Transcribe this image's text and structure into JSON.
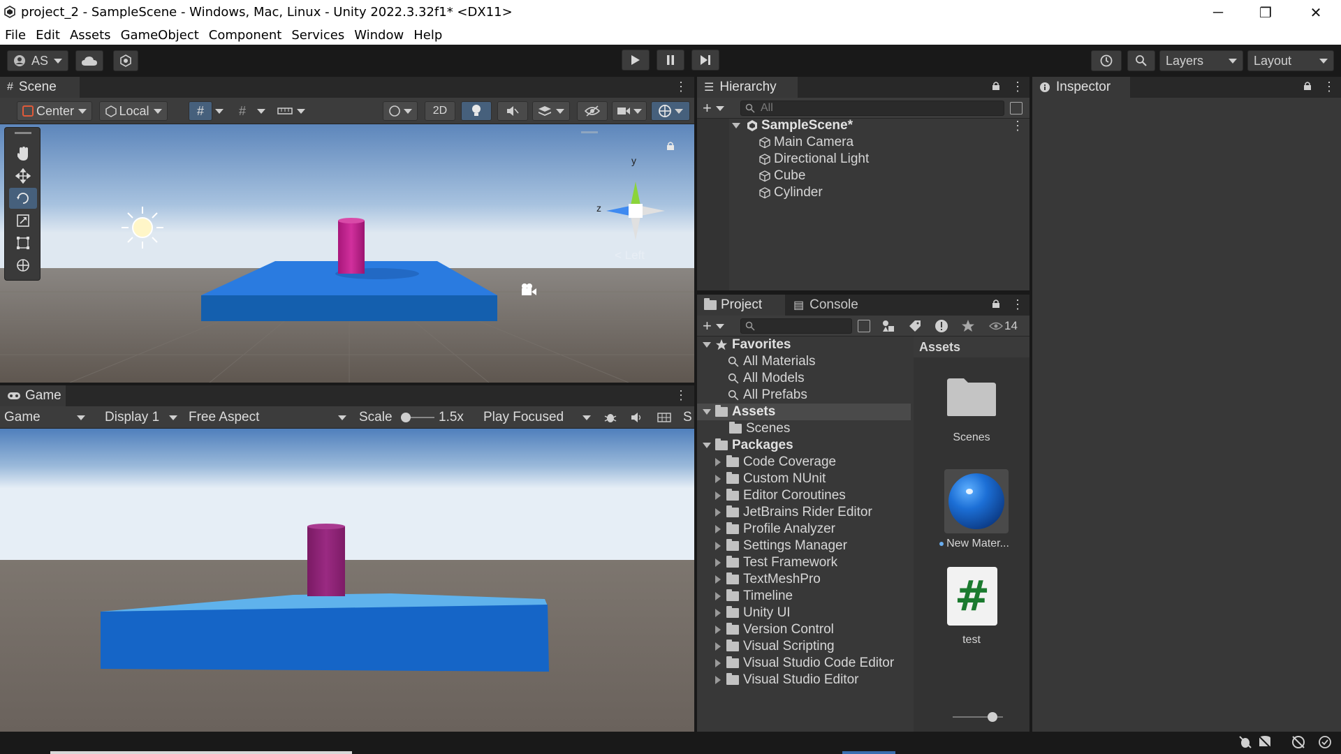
{
  "window": {
    "title": "project_2 - SampleScene - Windows, Mac, Linux - Unity 2022.3.32f1* <DX11>",
    "minimize_glyph": "─",
    "restore_glyph": "❐",
    "close_glyph": "✕"
  },
  "menu": [
    "File",
    "Edit",
    "Assets",
    "GameObject",
    "Component",
    "Services",
    "Window",
    "Help"
  ],
  "toolbar": {
    "account_label": "AS",
    "layers_label": "Layers",
    "layout_label": "Layout"
  },
  "scene": {
    "tab_label": "Scene",
    "pivot_label": "Center",
    "space_label": "Local",
    "mode_2d_label": "2D",
    "gizmo_y": "y",
    "gizmo_z": "z",
    "gizmo_view_label": "< Left"
  },
  "game": {
    "tab_label": "Game",
    "view_dropdown": "Game",
    "display_dropdown": "Display 1",
    "aspect_dropdown": "Free Aspect",
    "scale_label": "Scale",
    "scale_value": "1.5x",
    "play_mode_dropdown": "Play Focused",
    "cut_label": "S"
  },
  "hierarchy": {
    "tab_label": "Hierarchy",
    "search_placeholder": "All",
    "scene_name": "SampleScene*",
    "objects": [
      "Main Camera",
      "Directional Light",
      "Cube",
      "Cylinder"
    ]
  },
  "inspector": {
    "tab_label": "Inspector"
  },
  "project": {
    "tab_label": "Project",
    "console_tab_label": "Console",
    "hidden_count": "14",
    "favorites_label": "Favorites",
    "favorites": [
      "All Materials",
      "All Models",
      "All Prefabs"
    ],
    "assets_label": "Assets",
    "assets_children": [
      "Scenes"
    ],
    "packages_label": "Packages",
    "packages": [
      "Code Coverage",
      "Custom NUnit",
      "Editor Coroutines",
      "JetBrains Rider Editor",
      "Profile Analyzer",
      "Settings Manager",
      "Test Framework",
      "TextMeshPro",
      "Timeline",
      "Unity UI",
      "Version Control",
      "Visual Scripting",
      "Visual Studio Code Editor",
      "Visual Studio Editor"
    ],
    "grid_header": "Assets",
    "grid_items": [
      {
        "label": "Scenes",
        "icon": "folder-icon"
      },
      {
        "label": "New Mater...",
        "icon": "material-sphere-icon"
      },
      {
        "label": "test",
        "icon": "csharp-script-icon"
      }
    ],
    "script_glyph": "#"
  },
  "colors": {
    "platform_blue": "#1f6fd1",
    "cylinder_magenta": "#c2248f",
    "sky_top": "#5a86bd",
    "ground": "#6a625c"
  }
}
